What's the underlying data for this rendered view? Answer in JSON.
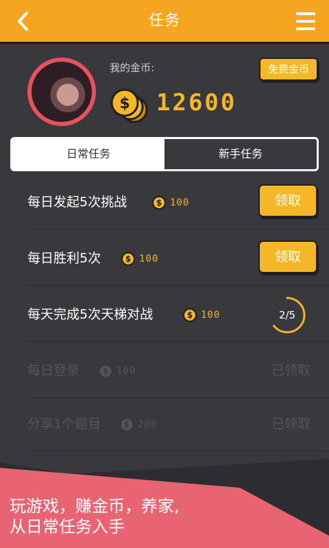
{
  "header": {
    "title": "任务",
    "back_icon": "chevron-left-icon",
    "menu_icon": "hamburger-menu-icon"
  },
  "profile": {
    "coin_label": "我的金币:",
    "coin_total": "12600",
    "free_coins_label": "免费金币"
  },
  "tabs": [
    {
      "label": "日常任务",
      "active": true
    },
    {
      "label": "新手任务",
      "active": false
    }
  ],
  "tasks": [
    {
      "name": "每日发起5次挑战",
      "reward": "100",
      "status": "claimable",
      "action_label": "领取"
    },
    {
      "name": "每日胜利5次",
      "reward": "100",
      "status": "claimable",
      "action_label": "领取"
    },
    {
      "name": "每天完成5次天梯对战",
      "reward": "100",
      "status": "in_progress",
      "progress_text": "2/5",
      "progress_fraction": 0.4
    },
    {
      "name": "每日登录",
      "reward": "100",
      "status": "claimed",
      "claimed_label": "已领取"
    },
    {
      "name": "分享1个题目",
      "reward": "200",
      "status": "claimed",
      "claimed_label": "已领取"
    }
  ],
  "promo": {
    "line1": "玩游戏，赚金币，养家,",
    "line2": "从日常任务入手"
  },
  "colors": {
    "accent": "#f5a520",
    "coin": "#f5b628",
    "background": "#38383d",
    "promo": "#e96473",
    "avatar_ring": "#e8525f"
  }
}
